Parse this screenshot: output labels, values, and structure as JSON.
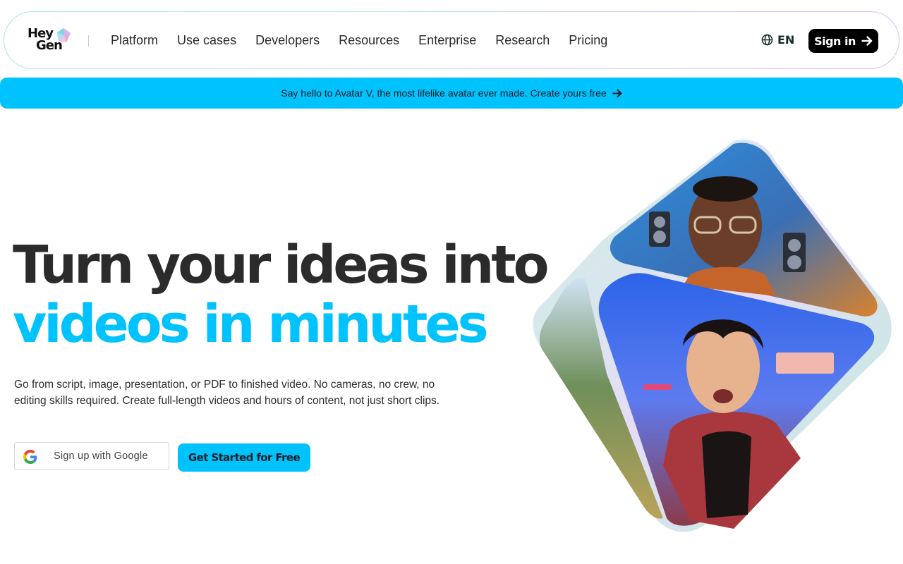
{
  "nav": {
    "logo": {
      "line1": "Hey",
      "line2": "Gen"
    },
    "links": [
      "Platform",
      "Use cases",
      "Developers",
      "Resources",
      "Enterprise",
      "Research",
      "Pricing"
    ],
    "language": "EN",
    "signin_label": "Sign in"
  },
  "banner": {
    "text": "Say hello to Avatar V, the most lifelike avatar ever made. Create yours free"
  },
  "hero": {
    "headline_line1": "Turn your ideas into",
    "headline_line2": "videos in minutes",
    "subtext": "Go from script, image, presentation, or PDF to finished video. No cameras, no crew, no editing skills required. Create full-length videos and hours of content, not just short clips.",
    "google_button_label": "Sign up with Google",
    "cta_label": "Get Started for Free"
  },
  "colors": {
    "accent": "#00c2fd",
    "text_dark": "#2b2b2b",
    "button_dark": "#000000"
  },
  "icons": [
    "heygen-logo-gem",
    "globe-icon",
    "arrow-right-icon",
    "google-icon"
  ]
}
